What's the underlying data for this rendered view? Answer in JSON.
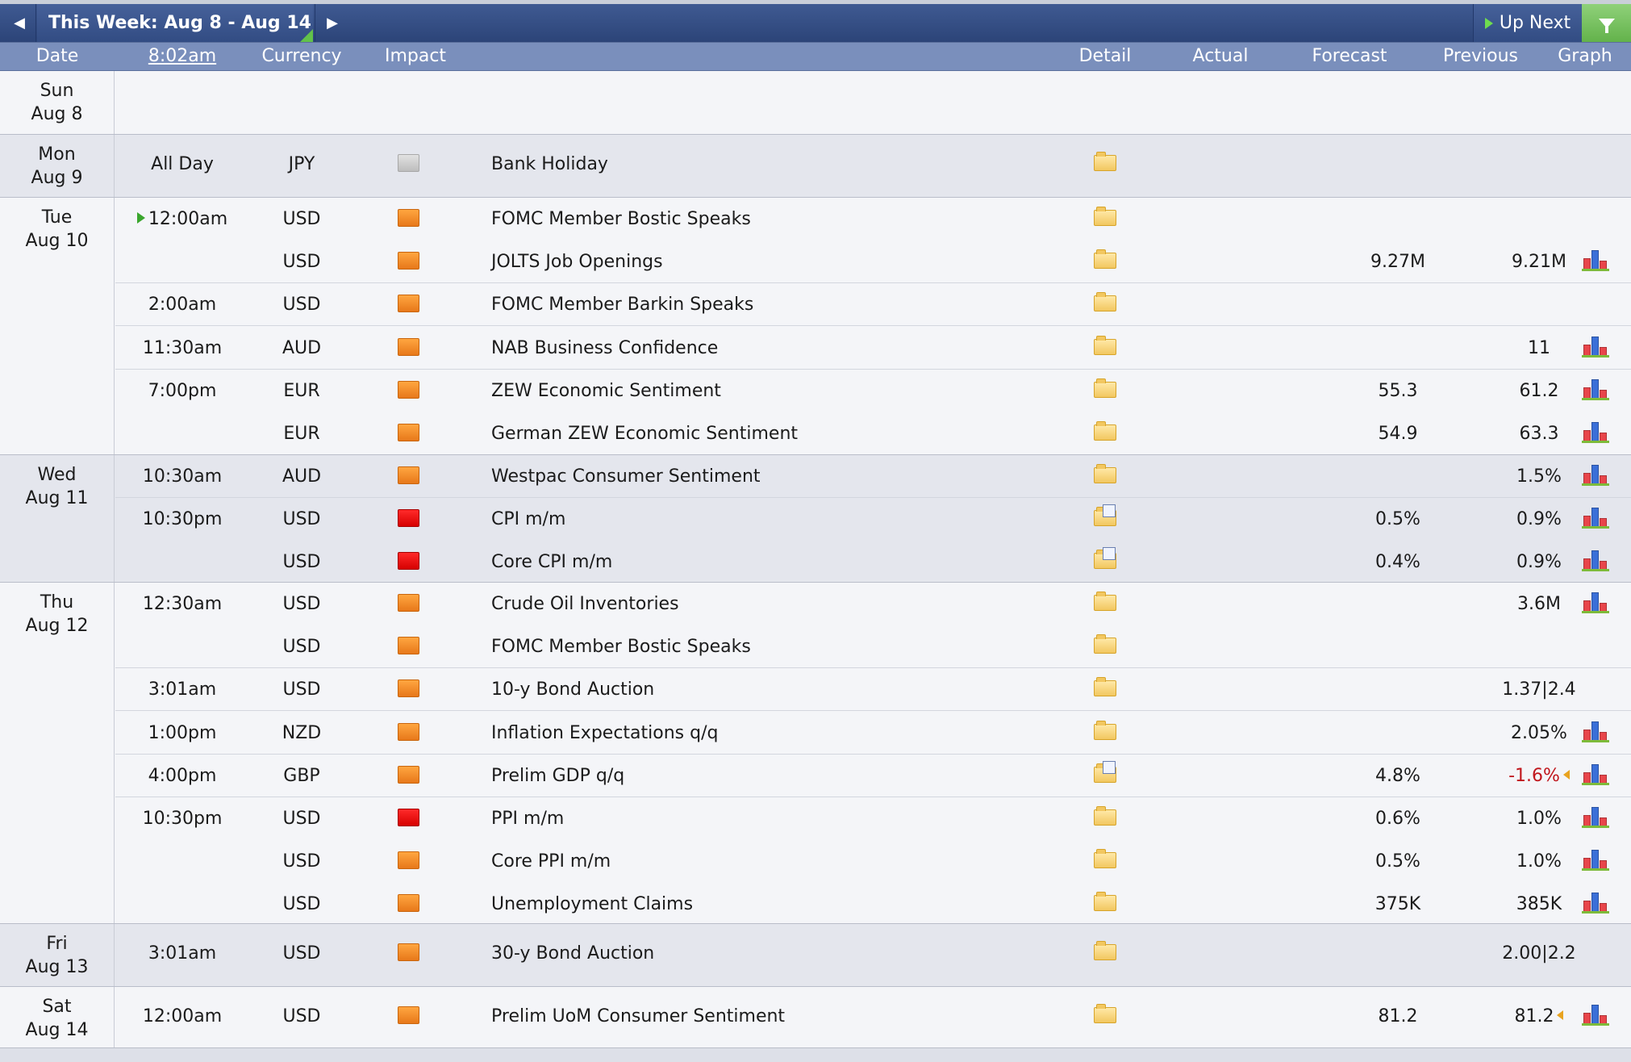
{
  "toolbar": {
    "prev_icon": "left-arrow-icon",
    "title": "This Week: Aug 8 - Aug 14",
    "next_icon": "right-arrow-icon",
    "up_next_label": "Up Next",
    "filter_icon": "filter-icon"
  },
  "header": {
    "date": "Date",
    "time": "8:02am",
    "currency": "Currency",
    "impact": "Impact",
    "detail": "Detail",
    "actual": "Actual",
    "forecast": "Forecast",
    "previous": "Previous",
    "graph": "Graph"
  },
  "days": [
    {
      "weekday": "Sun",
      "date": "Aug 8",
      "events": []
    },
    {
      "weekday": "Mon",
      "date": "Aug 9",
      "events": [
        {
          "time": "All Day",
          "currency": "JPY",
          "impact": "gray",
          "event": "Bank Holiday",
          "detail": "folder",
          "forecast": "",
          "previous": "",
          "graph": false
        }
      ]
    },
    {
      "weekday": "Tue",
      "date": "Aug 10",
      "events": [
        {
          "time": "12:00am",
          "currency": "USD",
          "impact": "orange",
          "event": "FOMC Member Bostic Speaks",
          "detail": "folder",
          "forecast": "",
          "previous": "",
          "graph": false,
          "up_next": true
        },
        {
          "time": "",
          "currency": "USD",
          "impact": "orange",
          "event": "JOLTS Job Openings",
          "detail": "folder",
          "forecast": "9.27M",
          "previous": "9.21M",
          "graph": true
        },
        {
          "time": "2:00am",
          "currency": "USD",
          "impact": "orange",
          "event": "FOMC Member Barkin Speaks",
          "detail": "folder",
          "forecast": "",
          "previous": "",
          "graph": false
        },
        {
          "time": "11:30am",
          "currency": "AUD",
          "impact": "orange",
          "event": "NAB Business Confidence",
          "detail": "folder",
          "forecast": "",
          "previous": "11",
          "graph": true
        },
        {
          "time": "7:00pm",
          "currency": "EUR",
          "impact": "orange",
          "event": "ZEW Economic Sentiment",
          "detail": "folder",
          "forecast": "55.3",
          "previous": "61.2",
          "graph": true
        },
        {
          "time": "",
          "currency": "EUR",
          "impact": "orange",
          "event": "German ZEW Economic Sentiment",
          "detail": "folder",
          "forecast": "54.9",
          "previous": "63.3",
          "graph": true
        }
      ]
    },
    {
      "weekday": "Wed",
      "date": "Aug 11",
      "events": [
        {
          "time": "10:30am",
          "currency": "AUD",
          "impact": "orange",
          "event": "Westpac Consumer Sentiment",
          "detail": "folder",
          "forecast": "",
          "previous": "1.5%",
          "graph": true
        },
        {
          "time": "10:30pm",
          "currency": "USD",
          "impact": "red",
          "event": "CPI m/m",
          "detail": "folder-doc",
          "forecast": "0.5%",
          "previous": "0.9%",
          "graph": true
        },
        {
          "time": "",
          "currency": "USD",
          "impact": "red",
          "event": "Core CPI m/m",
          "detail": "folder-doc",
          "forecast": "0.4%",
          "previous": "0.9%",
          "graph": true
        }
      ]
    },
    {
      "weekday": "Thu",
      "date": "Aug 12",
      "events": [
        {
          "time": "12:30am",
          "currency": "USD",
          "impact": "orange",
          "event": "Crude Oil Inventories",
          "detail": "folder",
          "forecast": "",
          "previous": "3.6M",
          "graph": true
        },
        {
          "time": "",
          "currency": "USD",
          "impact": "orange",
          "event": "FOMC Member Bostic Speaks",
          "detail": "folder",
          "forecast": "",
          "previous": "",
          "graph": false
        },
        {
          "time": "3:01am",
          "currency": "USD",
          "impact": "orange",
          "event": "10-y Bond Auction",
          "detail": "folder",
          "forecast": "",
          "previous": "1.37|2.4",
          "graph": false
        },
        {
          "time": "1:00pm",
          "currency": "NZD",
          "impact": "orange",
          "event": "Inflation Expectations q/q",
          "detail": "folder",
          "forecast": "",
          "previous": "2.05%",
          "graph": true
        },
        {
          "time": "4:00pm",
          "currency": "GBP",
          "impact": "orange",
          "event": "Prelim GDP q/q",
          "detail": "folder-doc",
          "forecast": "4.8%",
          "previous": "-1.6%",
          "previous_negative": true,
          "revised": true,
          "graph": true
        },
        {
          "time": "10:30pm",
          "currency": "USD",
          "impact": "red",
          "event": "PPI m/m",
          "detail": "folder",
          "forecast": "0.6%",
          "previous": "1.0%",
          "graph": true
        },
        {
          "time": "",
          "currency": "USD",
          "impact": "orange",
          "event": "Core PPI m/m",
          "detail": "folder",
          "forecast": "0.5%",
          "previous": "1.0%",
          "graph": true
        },
        {
          "time": "",
          "currency": "USD",
          "impact": "orange",
          "event": "Unemployment Claims",
          "detail": "folder",
          "forecast": "375K",
          "previous": "385K",
          "graph": true
        }
      ]
    },
    {
      "weekday": "Fri",
      "date": "Aug 13",
      "events": [
        {
          "time": "3:01am",
          "currency": "USD",
          "impact": "orange",
          "event": "30-y Bond Auction",
          "detail": "folder",
          "forecast": "",
          "previous": "2.00|2.2",
          "graph": false
        }
      ]
    },
    {
      "weekday": "Sat",
      "date": "Aug 14",
      "events": [
        {
          "time": "12:00am",
          "currency": "USD",
          "impact": "orange",
          "event": "Prelim UoM Consumer Sentiment",
          "detail": "folder",
          "forecast": "81.2",
          "previous": "81.2",
          "revised": true,
          "graph": true
        }
      ]
    }
  ],
  "colors": {
    "toolbar_bg": "#2c4478",
    "header_bg": "#7a8fbc",
    "impact_high": "#e00000",
    "impact_medium": "#f08a24",
    "impact_low": "#c8c8c8",
    "negative_value": "#c0161c",
    "filter_button": "#63b24b"
  }
}
